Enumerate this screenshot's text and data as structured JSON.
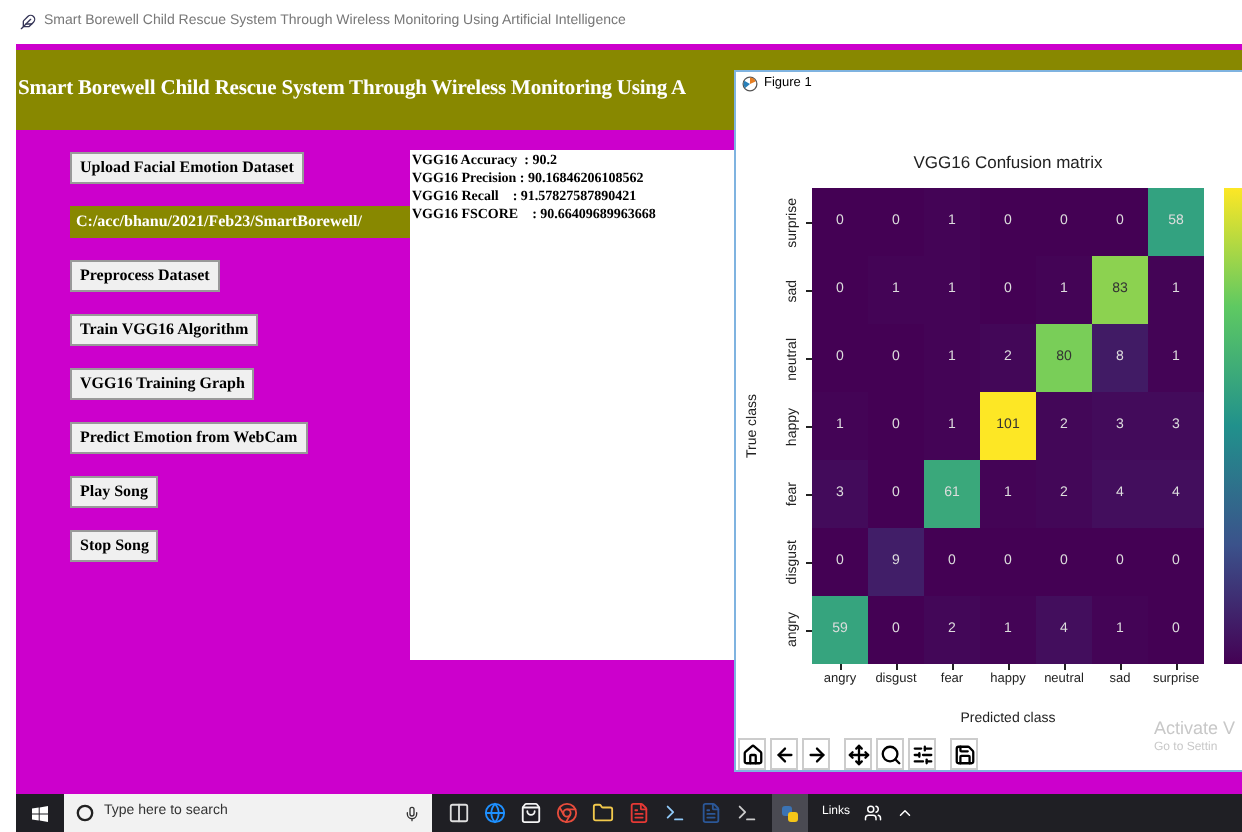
{
  "window": {
    "title": "Smart Borewell Child Rescue System Through Wireless Monitoring Using Artificial Intelligence"
  },
  "header": {
    "title": "Smart Borewell Child Rescue System Through Wireless Monitoring Using A"
  },
  "buttons": [
    "Upload Facial Emotion Dataset",
    "Preprocess Dataset",
    "Train VGG16 Algorithm",
    "VGG16 Training Graph",
    "Predict Emotion from WebCam",
    "Play Song",
    "Stop Song"
  ],
  "path_label": "C:/acc/bhanu/2021/Feb23/SmartBorewell/",
  "results": [
    "VGG16 Accuracy  : 90.2",
    "VGG16 Precision : 90.16846206108562",
    "VGG16 Recall    : 91.57827587890421",
    "VGG16 FSCORE    : 90.66409689963668"
  ],
  "figure": {
    "title": "Figure 1",
    "chart_title": "VGG16 Confusion matrix",
    "ylabel": "True class",
    "xlabel": "Predicted class",
    "rows": [
      {
        "label": "surprise",
        "values": [
          "0",
          "0",
          "1",
          "0",
          "0",
          "0",
          "58"
        ]
      },
      {
        "label": "sad",
        "values": [
          "0",
          "1",
          "1",
          "0",
          "1",
          "83",
          "1"
        ]
      },
      {
        "label": "neutral",
        "values": [
          "0",
          "0",
          "1",
          "2",
          "80",
          "8",
          "1"
        ]
      },
      {
        "label": "happy",
        "values": [
          "1",
          "0",
          "1",
          "101",
          "2",
          "3",
          "3"
        ]
      },
      {
        "label": "fear",
        "values": [
          "3",
          "0",
          "61",
          "1",
          "2",
          "4",
          "4"
        ]
      },
      {
        "label": "disgust",
        "values": [
          "0",
          "9",
          "0",
          "0",
          "0",
          "0",
          "0"
        ]
      },
      {
        "label": "angry",
        "values": [
          "59",
          "0",
          "2",
          "1",
          "4",
          "1",
          "0"
        ]
      }
    ],
    "columns": [
      "angry",
      "disgust",
      "fear",
      "happy",
      "neutral",
      "sad",
      "surprise"
    ]
  },
  "activation": [
    "Activate V",
    "Go to Settin"
  ],
  "taskbar": {
    "search_placeholder": "Type here to search",
    "links": "Links"
  }
}
